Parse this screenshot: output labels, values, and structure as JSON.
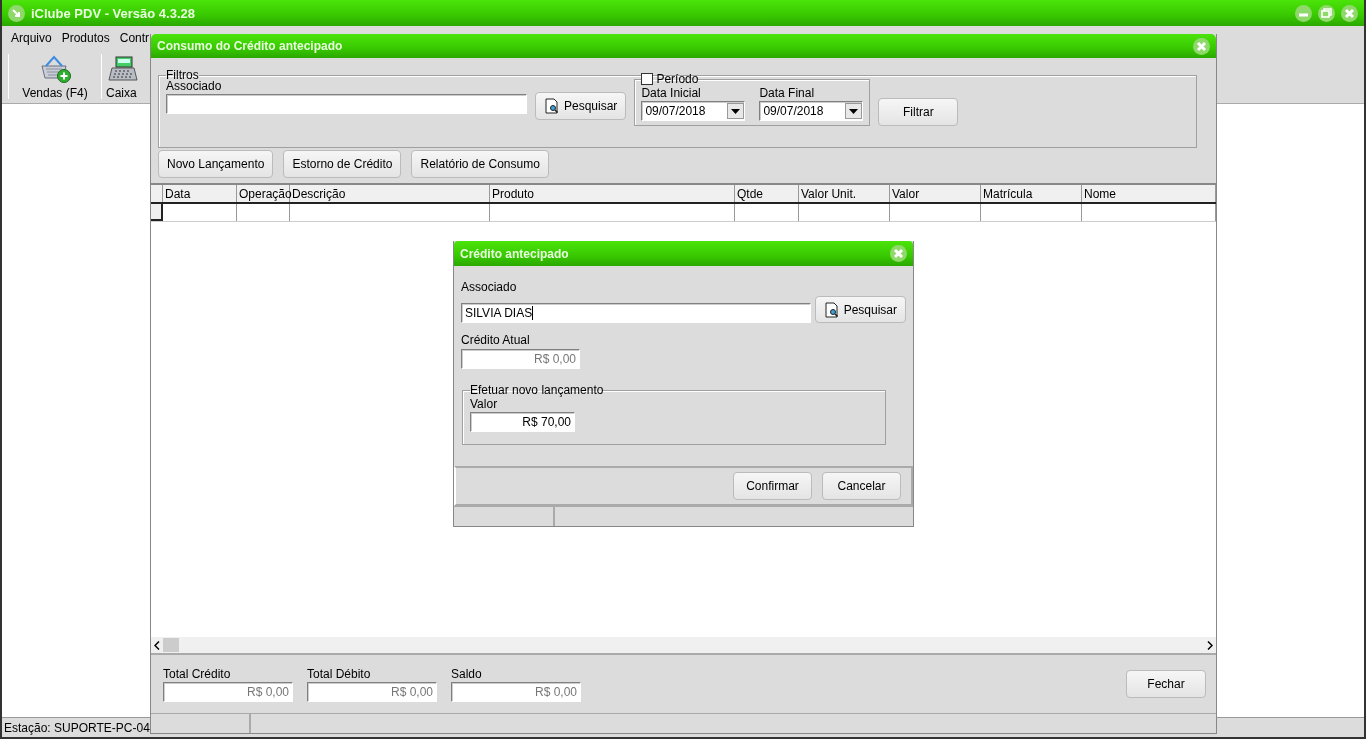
{
  "app": {
    "title": "iClube PDV - Versão 4.3.28"
  },
  "menu": [
    {
      "label": "Arquivo"
    },
    {
      "label": "Produtos"
    },
    {
      "label": "Contr"
    }
  ],
  "toolbar": [
    {
      "label": "Vendas (F4)",
      "kind": "sales"
    },
    {
      "label": "Caixa",
      "kind": "register"
    }
  ],
  "status_bar": "Estação: SUPORTE-PC-04",
  "consumo": {
    "title": "Consumo do Crédito antecipado",
    "filters": {
      "legend": "Filtros",
      "associado_label": "Associado",
      "search_button": "Pesquisar",
      "period": {
        "label": "Período",
        "checked": false,
        "start_label": "Data Inicial",
        "start_value": "09/07/2018",
        "end_label": "Data Final",
        "end_value": "09/07/2018"
      },
      "filter_button": "Filtrar"
    },
    "actions": [
      "Novo Lançamento",
      "Estorno de Crédito",
      "Relatório de Consumo"
    ],
    "table": {
      "columns": [
        "Data",
        "Operação",
        "Descrição",
        "Produto",
        "Qtde",
        "Valor Unit.",
        "Valor",
        "Matrícula",
        "Nome"
      ]
    },
    "totals": [
      {
        "label": "Total Crédito",
        "value": "R$ 0,00"
      },
      {
        "label": "Total Débito",
        "value": "R$ 0,00"
      },
      {
        "label": "Saldo",
        "value": "R$ 0,00"
      }
    ],
    "close_button": "Fechar"
  },
  "dialog": {
    "title": "Crédito antecipado",
    "associado_label": "Associado",
    "associado_value": "SILVIA DIAS",
    "search_button": "Pesquisar",
    "credit_label": "Crédito Atual",
    "credit_value": "R$ 0,00",
    "group_legend": "Efetuar novo lançamento",
    "valor_label": "Valor",
    "valor_value": "R$ 70,00",
    "buttons": [
      "Confirmar",
      "Cancelar"
    ]
  }
}
